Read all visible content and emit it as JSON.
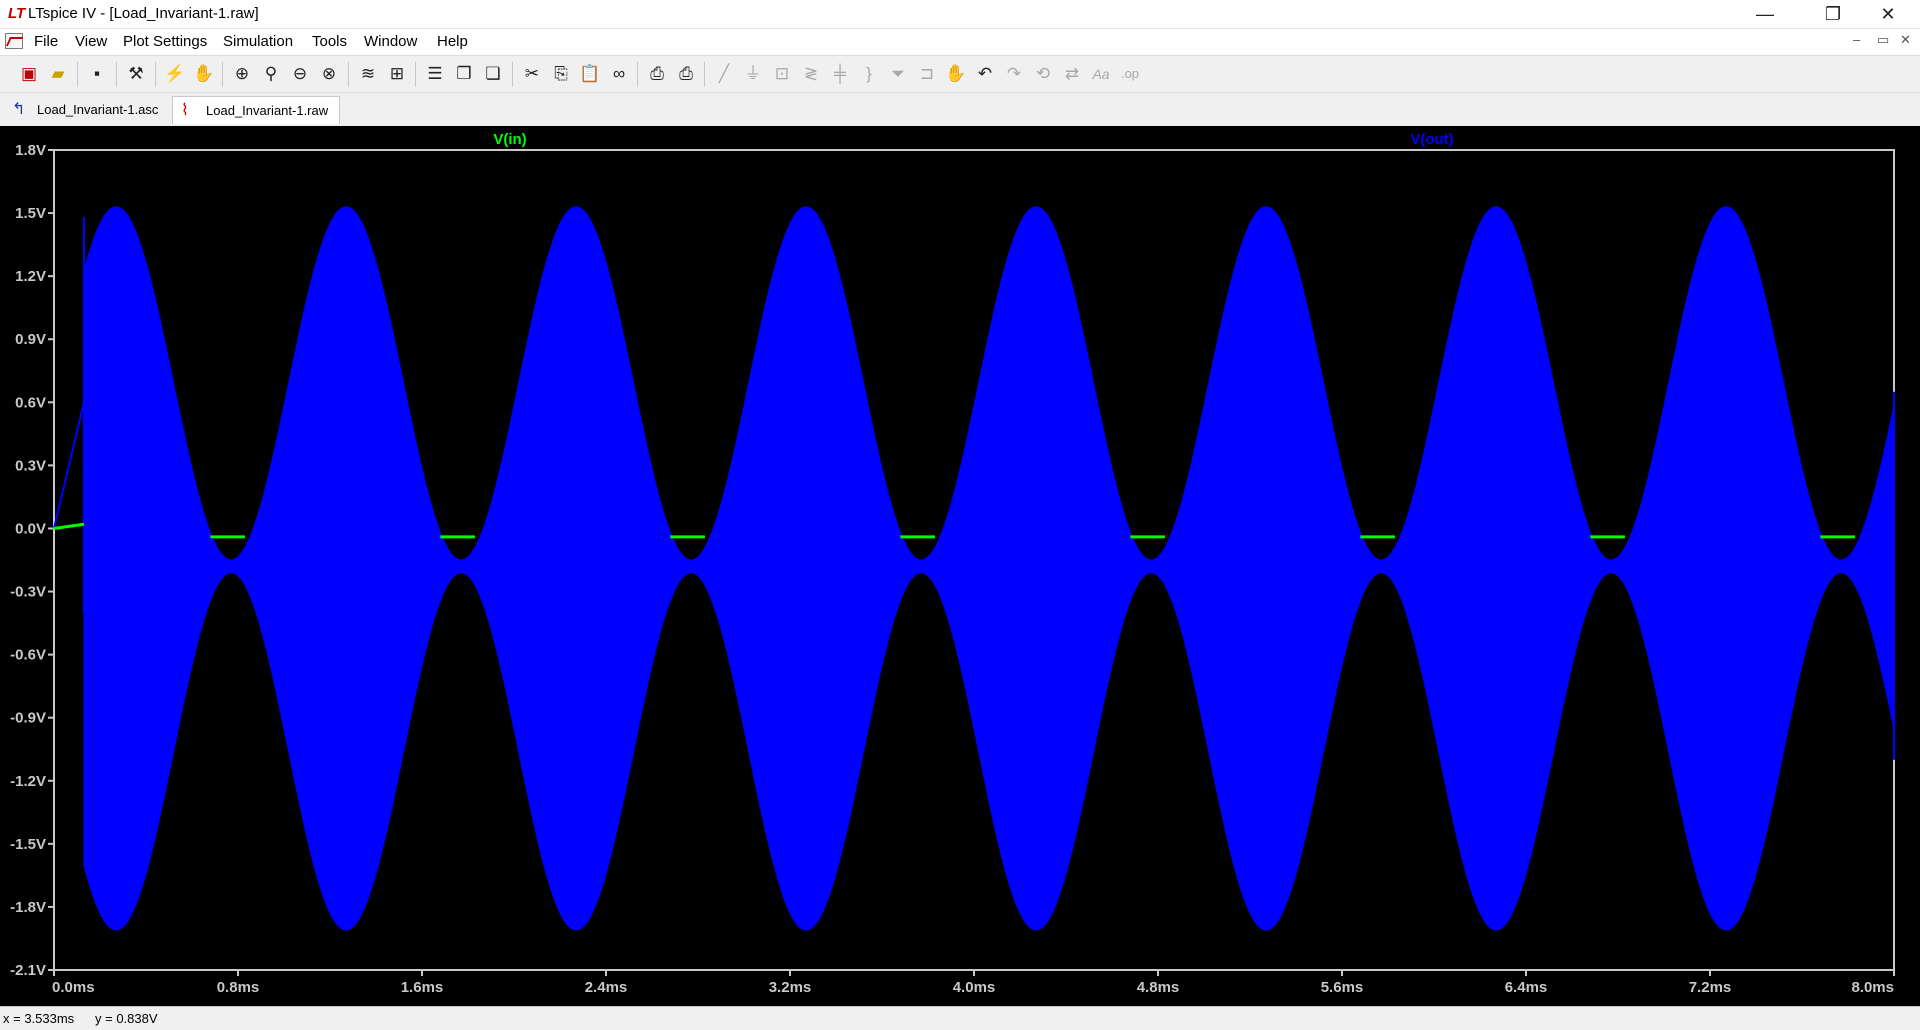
{
  "window": {
    "app_icon": "LT",
    "title": "LTspice IV - [Load_Invariant-1.raw]",
    "minimize": "—",
    "restore": "❐",
    "close": "✕"
  },
  "menubar": {
    "items": [
      "File",
      "View",
      "Plot Settings",
      "Simulation",
      "Tools",
      "Window",
      "Help"
    ],
    "mdi": {
      "minimize": "–",
      "restore": "▭",
      "close": "✕"
    }
  },
  "toolbar": {
    "buttons": [
      "new-schematic",
      "open",
      "save",
      "control-panel",
      "run",
      "halt",
      "zoom-area",
      "zoom-in",
      "zoom-out",
      "zoom-fit",
      "autorange",
      "add-trace",
      "tile-horizontal",
      "cascade",
      "tile-vertical",
      "cut",
      "copy",
      "paste",
      "find",
      "print-preview",
      "print",
      "draw-wire",
      "ground",
      "label-net",
      "resistor",
      "capacitor",
      "inductor",
      "diode",
      "component",
      "move",
      "drag",
      "undo",
      "redo",
      "rotate",
      "mirror",
      "text",
      "spice-directive"
    ]
  },
  "tabs": [
    {
      "label": "Load_Invariant-1.asc",
      "icon": "schematic-icon",
      "active": false
    },
    {
      "label": "Load_Invariant-1.raw",
      "icon": "waveform-icon",
      "active": true
    }
  ],
  "chart_data": {
    "type": "line",
    "background": "#000000",
    "grid": false,
    "xlim": [
      0,
      8.0
    ],
    "ylim": [
      -2.1,
      1.8
    ],
    "x_unit": "ms",
    "y_unit": "V",
    "x_ticks": [
      "0.0ms",
      "0.8ms",
      "1.6ms",
      "2.4ms",
      "3.2ms",
      "4.0ms",
      "4.8ms",
      "5.6ms",
      "6.4ms",
      "7.2ms",
      "8.0ms"
    ],
    "x_tick_values": [
      0,
      0.8,
      1.6,
      2.4,
      3.2,
      4.0,
      4.8,
      5.6,
      6.4,
      7.2,
      8.0
    ],
    "y_ticks": [
      "1.8V",
      "1.5V",
      "1.2V",
      "0.9V",
      "0.6V",
      "0.3V",
      "0.0V",
      "-0.3V",
      "-0.6V",
      "-0.9V",
      "-1.2V",
      "-1.5V",
      "-1.8V",
      "-2.1V"
    ],
    "y_tick_values": [
      1.8,
      1.5,
      1.2,
      0.9,
      0.6,
      0.3,
      0.0,
      -0.3,
      -0.6,
      -0.9,
      -1.2,
      -1.5,
      -1.8,
      -2.1
    ],
    "series": [
      {
        "name": "V(in)",
        "color": "#00ff00",
        "description": "visible only in troughs of V(out) envelope, approx 0V",
        "segments_ms": [
          [
            0.68,
            0.83
          ],
          [
            1.68,
            1.83
          ],
          [
            2.68,
            2.83
          ],
          [
            3.68,
            3.83
          ],
          [
            4.68,
            4.83
          ],
          [
            5.68,
            5.83
          ],
          [
            6.68,
            6.83
          ],
          [
            7.68,
            7.83
          ]
        ],
        "value_v": -0.04
      },
      {
        "name": "V(out)",
        "color": "#0000ff",
        "envelope": {
          "upper_max": 1.53,
          "upper_min": -0.15,
          "lower_max": -0.21,
          "lower_min": -1.91,
          "upper_peaks_ms": [
            0.28,
            1.27,
            2.27,
            3.27,
            4.27,
            5.27,
            6.27,
            7.27
          ],
          "upper_troughs_ms": [
            0.77,
            1.77,
            2.77,
            3.77,
            4.77,
            5.77,
            6.77,
            7.77
          ],
          "start_ms": 0.13,
          "end_ms": 8.0
        },
        "startup_points": [
          [
            0.0,
            0.0
          ],
          [
            0.13,
            0.6
          ]
        ],
        "end_value_top": 0.65,
        "end_value_bottom": -1.1
      }
    ]
  },
  "status": {
    "x_readout": "x = 3.533ms",
    "y_readout": "y = 0.838V"
  }
}
